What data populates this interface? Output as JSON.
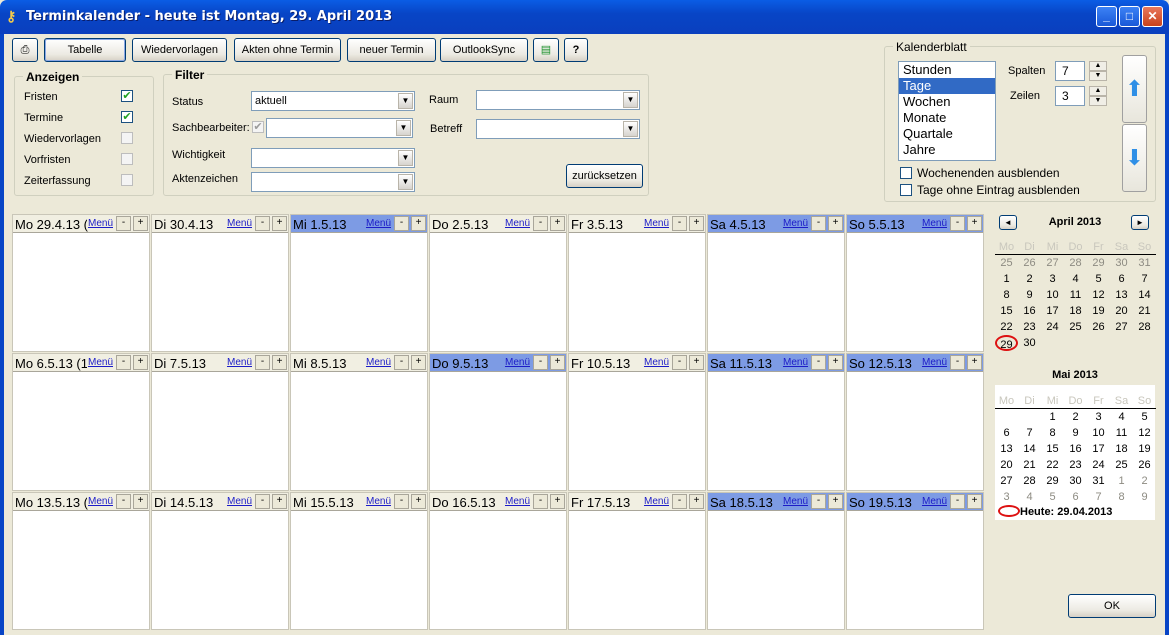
{
  "window": {
    "title": "Terminkalender - heute ist Montag, 29. April 2013"
  },
  "toolbar": {
    "print_icon": "printer-icon",
    "tabelle": "Tabelle",
    "wiedervorlagen": "Wiedervorlagen",
    "akten_ohne_termin": "Akten ohne Termin",
    "neuer_termin": "neuer Termin",
    "outlooksync": "OutlookSync",
    "export_icon": "table-export-icon",
    "help": "?"
  },
  "anzeigen": {
    "title": "Anzeigen",
    "items": [
      {
        "label": "Fristen",
        "checked": true
      },
      {
        "label": "Termine",
        "checked": true
      },
      {
        "label": "Wiedervorlagen",
        "checked": false
      },
      {
        "label": "Vorfristen",
        "checked": false
      },
      {
        "label": "Zeiterfassung",
        "checked": false
      }
    ]
  },
  "filter": {
    "title": "Filter",
    "status_label": "Status",
    "status_value": "aktuell",
    "sachbearbeiter_label": "Sachbearbeiter:",
    "sachbearbeiter_value": "",
    "wichtigkeit_label": "Wichtigkeit",
    "wichtigkeit_value": "",
    "aktenzeichen_label": "Aktenzeichen",
    "aktenzeichen_value": "",
    "raum_label": "Raum",
    "raum_value": "",
    "betreff_label": "Betreff",
    "betreff_value": "",
    "reset": "zurücksetzen"
  },
  "kalenderblatt": {
    "title": "Kalenderblatt",
    "views": [
      "Stunden",
      "Tage",
      "Wochen",
      "Monate",
      "Quartale",
      "Jahre"
    ],
    "selected": "Tage",
    "spalten_label": "Spalten",
    "spalten_value": "7",
    "zeilen_label": "Zeilen",
    "zeilen_value": "3",
    "hide_weekends": "Wochenenden ausblenden",
    "hide_empty_days": "Tage ohne Eintrag ausblenden"
  },
  "calendar": {
    "menu_label": "Menü",
    "minus": "-",
    "plus": "+",
    "rows": [
      [
        {
          "date": "Mo 29.4.13 (",
          "weekend": false
        },
        {
          "date": "Di 30.4.13",
          "weekend": false
        },
        {
          "date": "Mi 1.5.13",
          "weekend": true
        },
        {
          "date": "Do 2.5.13",
          "weekend": false
        },
        {
          "date": "Fr 3.5.13",
          "weekend": false
        },
        {
          "date": "Sa 4.5.13",
          "weekend": true
        },
        {
          "date": "So 5.5.13",
          "weekend": true
        }
      ],
      [
        {
          "date": "Mo 6.5.13 (1",
          "weekend": false
        },
        {
          "date": "Di 7.5.13",
          "weekend": false
        },
        {
          "date": "Mi 8.5.13",
          "weekend": false
        },
        {
          "date": "Do 9.5.13",
          "weekend": true
        },
        {
          "date": "Fr 10.5.13",
          "weekend": false
        },
        {
          "date": "Sa 11.5.13",
          "weekend": true
        },
        {
          "date": "So 12.5.13",
          "weekend": true
        }
      ],
      [
        {
          "date": "Mo 13.5.13 (",
          "weekend": false
        },
        {
          "date": "Di 14.5.13",
          "weekend": false
        },
        {
          "date": "Mi 15.5.13",
          "weekend": false
        },
        {
          "date": "Do 16.5.13",
          "weekend": false
        },
        {
          "date": "Fr 17.5.13",
          "weekend": false
        },
        {
          "date": "Sa 18.5.13",
          "weekend": true
        },
        {
          "date": "So 19.5.13",
          "weekend": true
        }
      ]
    ]
  },
  "minicalendar": {
    "prev": "◄",
    "next": "►",
    "dow": [
      "Mo",
      "Di",
      "Mi",
      "Do",
      "Fr",
      "Sa",
      "So"
    ],
    "april": {
      "title": "April 2013",
      "days": [
        [
          "25",
          "26",
          "27",
          "28",
          "29",
          "30",
          "31"
        ],
        [
          "1",
          "2",
          "3",
          "4",
          "5",
          "6",
          "7"
        ],
        [
          "8",
          "9",
          "10",
          "11",
          "12",
          "13",
          "14"
        ],
        [
          "15",
          "16",
          "17",
          "18",
          "19",
          "20",
          "21"
        ],
        [
          "22",
          "23",
          "24",
          "25",
          "26",
          "27",
          "28"
        ],
        [
          "29",
          "30",
          "",
          "",
          "",
          "",
          ""
        ]
      ]
    },
    "mai": {
      "title": "Mai 2013",
      "days": [
        [
          "",
          "",
          "1",
          "2",
          "3",
          "4",
          "5"
        ],
        [
          "6",
          "7",
          "8",
          "9",
          "10",
          "11",
          "12"
        ],
        [
          "13",
          "14",
          "15",
          "16",
          "17",
          "18",
          "19"
        ],
        [
          "20",
          "21",
          "22",
          "23",
          "24",
          "25",
          "26"
        ],
        [
          "27",
          "28",
          "29",
          "30",
          "31",
          "1",
          "2"
        ],
        [
          "3",
          "4",
          "5",
          "6",
          "7",
          "8",
          "9"
        ]
      ]
    },
    "today_label": "Heute: 29.04.2013"
  },
  "ok": "OK"
}
